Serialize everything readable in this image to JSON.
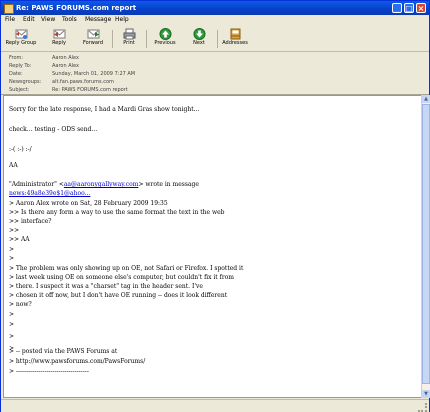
{
  "window": {
    "title": "Re: PAWS FORUMS.com report"
  },
  "menu": [
    "File",
    "Edit",
    "View",
    "Tools",
    "Message",
    "Help"
  ],
  "toolbar": {
    "reply_group": "Reply Group",
    "reply": "Reply",
    "forward": "Forward",
    "print": "Print",
    "previous": "Previous",
    "next": "Next",
    "addresses": "Addresses"
  },
  "headers": [
    {
      "key": "From:",
      "value": "Aaron Alex"
    },
    {
      "key": "Reply To:",
      "value": "Aaron Alex"
    },
    {
      "key": "Date:",
      "value": "Sunday, March 01, 2009 7:27 AM"
    },
    {
      "key": "Newsgroups:",
      "value": "alt.fan.paws.forums.com"
    },
    {
      "key": "Subject:",
      "value": "Re: PAWS FORUMS.com report"
    }
  ],
  "message": {
    "lines": [
      "Sorry for the late response, I had a Mardi Gras show tonight...",
      "",
      "check... testing - ODS send...",
      "",
      "   :-( :-) :-/",
      "",
      "AA",
      "",
      "\"Administrator\" <",
      "news:49a8e39e$1@ahoo...",
      "> Aaron Alex wrote on Sat, 28 February 2009 19:35",
      ">> Is there any form a way to use the same format the text in the web",
      ">> interface?",
      ">>",
      ">> AA",
      ">",
      ">",
      "> The problem was only showing up on OE, not Safari or Firefox. I spotted it",
      "> last week using OE on someone else's computer, but couldn't fix it from",
      "> there. I suspect it was a \"charset\" tag in the header sent. I've",
      "> chosen it off now, but I don't have OE running -- does it look different",
      "> now?",
      ">",
      ">",
      ">",
      ">",
      "> -- posted via the PAWS Forums at",
      "> http://www.pawsforums.com/PawsForums/",
      "> ------------------------------------"
    ],
    "email_link": "aa@aaronygallyway.com",
    "after_link": "> wrote in message"
  }
}
